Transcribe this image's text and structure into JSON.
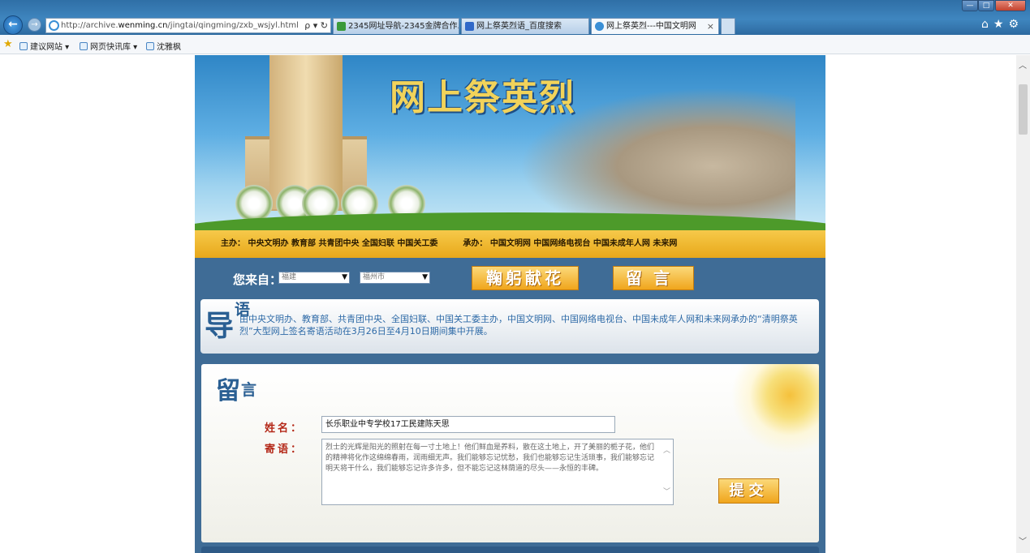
{
  "browser": {
    "address": {
      "prefix": "http://archive.",
      "host": "wenming.cn",
      "path": "/jingtai/qingming/zxb_wsjyl.html",
      "tools": "ρ ▾ ↻"
    },
    "tabs": [
      {
        "label": "2345网址导航-2345金牌合作...",
        "icon_color": "#3a9a3a"
      },
      {
        "label": "网上祭英烈语_百度搜索",
        "icon_color": "#3068c8"
      },
      {
        "label": "网上祭英烈---中国文明网",
        "icon_color": "#3a8fd6"
      }
    ],
    "active_tab_close": "×",
    "window_controls": {
      "minimize": "—",
      "maximize": "□",
      "close": "✕"
    },
    "toolbar_icons": [
      "home-icon",
      "star-icon",
      "gear-icon"
    ],
    "toolbar_glyphs": "⌂★⚙",
    "favorites": [
      {
        "label": "建议网站 ▾"
      },
      {
        "label": "网页快讯库 ▾"
      },
      {
        "label": "沈雅枫"
      }
    ]
  },
  "page": {
    "banner_title": "网上祭英烈",
    "sponsors": {
      "host_label": "主办：",
      "hosts": "中央文明办 教育部 共青团中央 全国妇联 中国关工委",
      "organizer_label": "承办：",
      "organizers": "中国文明网 中国网络电视台 中国未成年人网 未来网"
    },
    "from": {
      "label": "您来自：",
      "province": "福建",
      "city": "福州市"
    },
    "buttons": {
      "tribute": "鞠躬献花",
      "message": "留言",
      "submit": "提交"
    },
    "guide": {
      "big": "导",
      "small": "语",
      "text": "由中央文明办、教育部、共青团中央、全国妇联、中国关工委主办，中国文明网、中国网络电视台、中国未成年人网和未来网承办的“清明祭英烈”大型网上签名寄语活动在3月26日至4月10日期间集中开展。"
    },
    "message_form": {
      "heading_big": "留",
      "heading_small": "言",
      "name_label": "姓名：",
      "name_value": "长乐职业中专学校17工民建陈天思",
      "words_label": "寄语：",
      "words_value": "烈士的光辉是阳光的照射在每一寸土地上！他们鲜血是养料，散在这土地上，开了美丽的栀子花，他们的精神将化作这绵绵春雨，润雨细无声。我们能够忘记忧愁，我们也能够忘记生活琐事，我们能够忘记明天将干什么，我们能够忘记许多许多，但不能忘记这林荫道的尽头——永恒的丰碑。"
    }
  }
}
